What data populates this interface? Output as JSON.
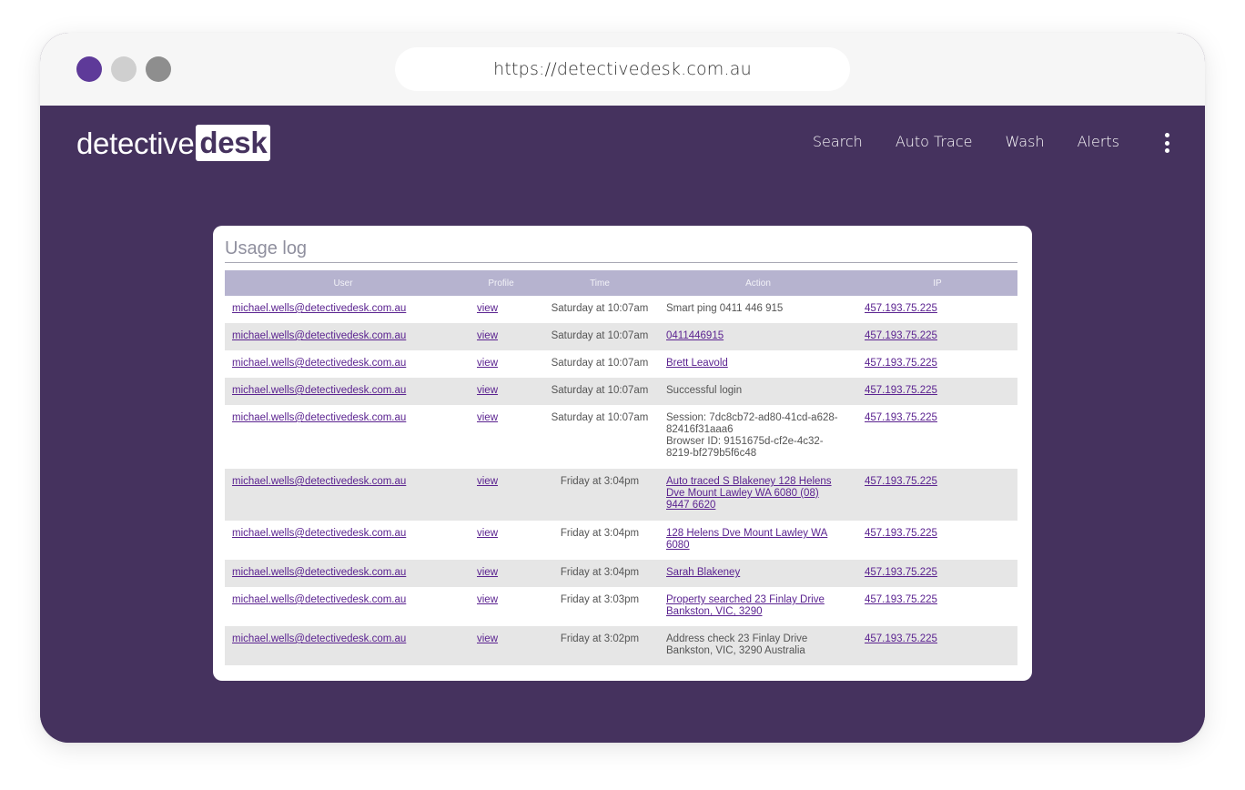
{
  "browser": {
    "url": "https://detectivedesk.com.au",
    "dot_colors": [
      "#5e3a99",
      "#cfcfcf",
      "#8e8e8e"
    ]
  },
  "brand": {
    "logo_part1": "detective",
    "logo_part2": "desk",
    "primary_color": "#45325e",
    "link_color": "#5b2390"
  },
  "nav": {
    "items": [
      "Search",
      "Auto Trace",
      "Wash",
      "Alerts"
    ],
    "more_icon": "more-vertical-icon"
  },
  "usage_log": {
    "title": "Usage log",
    "columns": [
      "User",
      "Profile",
      "Time",
      "Action",
      "IP"
    ],
    "rows": [
      {
        "user": "michael.wells@detectivedesk.com.au",
        "profile": "view",
        "time": "Saturday at 10:07am",
        "action": [
          "Smart ping 0411 446 915"
        ],
        "action_link": false,
        "ip": "457.193.75.225"
      },
      {
        "user": "michael.wells@detectivedesk.com.au",
        "profile": "view",
        "time": "Saturday at 10:07am",
        "action": [
          "0411446915"
        ],
        "action_link": true,
        "ip": "457.193.75.225"
      },
      {
        "user": "michael.wells@detectivedesk.com.au",
        "profile": "view",
        "time": "Saturday at 10:07am",
        "action": [
          "Brett Leavold"
        ],
        "action_link": true,
        "ip": "457.193.75.225"
      },
      {
        "user": "michael.wells@detectivedesk.com.au",
        "profile": "view",
        "time": "Saturday at 10:07am",
        "action": [
          "Successful login"
        ],
        "action_link": false,
        "ip": "457.193.75.225"
      },
      {
        "user": "michael.wells@detectivedesk.com.au",
        "profile": "view",
        "time": "Saturday at 10:07am",
        "action": [
          "Session: 7dc8cb72-ad80-41cd-a628-",
          "82416f31aaa6",
          "Browser ID: 9151675d-cf2e-4c32-",
          "8219-bf279b5f6c48"
        ],
        "action_link": false,
        "ip": "457.193.75.225"
      },
      {
        "user": "michael.wells@detectivedesk.com.au",
        "profile": "view",
        "time": "Friday at 3:04pm",
        "action": [
          "Auto traced S Blakeney 128 Helens",
          "Dve Mount Lawley WA 6080 (08)",
          "9447 6620"
        ],
        "action_link": true,
        "ip": "457.193.75.225"
      },
      {
        "user": "michael.wells@detectivedesk.com.au",
        "profile": "view",
        "time": "Friday at 3:04pm",
        "action": [
          "128 Helens Dve Mount Lawley WA",
          "6080"
        ],
        "action_link": true,
        "ip": "457.193.75.225"
      },
      {
        "user": "michael.wells@detectivedesk.com.au",
        "profile": "view",
        "time": "Friday at 3:04pm",
        "action": [
          "Sarah Blakeney"
        ],
        "action_link": true,
        "ip": "457.193.75.225"
      },
      {
        "user": "michael.wells@detectivedesk.com.au",
        "profile": "view",
        "time": "Friday at 3:03pm",
        "action": [
          "Property searched 23 Finlay Drive",
          "Bankston, VIC, 3290"
        ],
        "action_link": true,
        "ip": "457.193.75.225"
      },
      {
        "user": "michael.wells@detectivedesk.com.au",
        "profile": "view",
        "time": "Friday at 3:02pm",
        "action": [
          "Address check 23 Finlay Drive",
          "Bankston, VIC, 3290 Australia"
        ],
        "action_link": false,
        "ip": "457.193.75.225"
      }
    ]
  }
}
